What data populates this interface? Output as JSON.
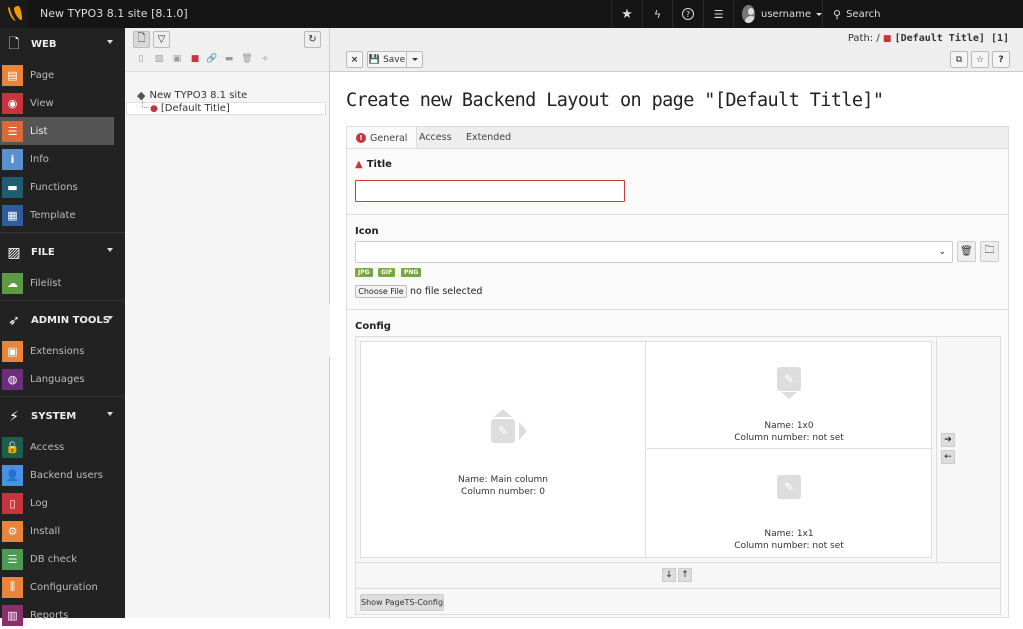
{
  "topbar": {
    "site_title": "New TYPO3 8.1 site [8.1.0]",
    "username": "username",
    "search_label": "Search",
    "icons": [
      "star-icon",
      "bolt-icon",
      "help-icon",
      "list-icon"
    ]
  },
  "sidebar": {
    "groups": [
      {
        "label": "WEB",
        "icon": "page-icon",
        "modules": [
          {
            "label": "Page",
            "color": "#e8853a"
          },
          {
            "label": "View",
            "color": "#c8333c"
          },
          {
            "label": "List",
            "color": "#d8693a",
            "active": true
          },
          {
            "label": "Info",
            "color": "#5b8fce"
          },
          {
            "label": "Functions",
            "color": "#1f5e6e"
          },
          {
            "label": "Template",
            "color": "#2e5d9e"
          }
        ]
      },
      {
        "label": "FILE",
        "icon": "image-icon",
        "modules": [
          {
            "label": "Filelist",
            "color": "#5c9a44"
          }
        ]
      },
      {
        "label": "ADMIN TOOLS",
        "icon": "rocket-icon",
        "modules": [
          {
            "label": "Extensions",
            "color": "#e8853a"
          },
          {
            "label": "Languages",
            "color": "#6a2e7a"
          }
        ]
      },
      {
        "label": "SYSTEM",
        "icon": "plug-icon",
        "modules": [
          {
            "label": "Access",
            "color": "#1f5e4e"
          },
          {
            "label": "Backend users",
            "color": "#4d8fe0"
          },
          {
            "label": "Log",
            "color": "#c8333c"
          },
          {
            "label": "Install",
            "color": "#e8853a"
          },
          {
            "label": "DB check",
            "color": "#4e9a52"
          },
          {
            "label": "Configuration",
            "color": "#e8853a"
          },
          {
            "label": "Reports",
            "color": "#8a2e6e"
          }
        ]
      }
    ]
  },
  "tree": {
    "root": "New TYPO3 8.1 site",
    "child": "[Default Title]"
  },
  "docheader": {
    "close_label": "×",
    "save_label": "Save",
    "path_label": "Path: /",
    "path_page": "[Default Title] [1]"
  },
  "main": {
    "title": "Create new Backend Layout on page \"[Default Title]\"",
    "tabs": [
      {
        "label": "General",
        "active": true,
        "error": true
      },
      {
        "label": "Access"
      },
      {
        "label": "Extended"
      }
    ],
    "fields": {
      "title_label": "Title",
      "title_value": "",
      "icon_label": "Icon",
      "icon_value": "",
      "badges": [
        "JPG",
        "GIF",
        "PNG"
      ],
      "choose_file": "Choose File",
      "no_file": "no file selected",
      "config_label": "Config"
    },
    "grid": {
      "cells": [
        {
          "name": "Name: Main column",
          "col": "Column number: 0"
        },
        {
          "name": "Name: 1x0",
          "col": "Column number: not set"
        },
        {
          "name": "Name: 1x1",
          "col": "Column number: not set"
        }
      ],
      "show_ts_label": "Show PageTS-Config"
    }
  }
}
